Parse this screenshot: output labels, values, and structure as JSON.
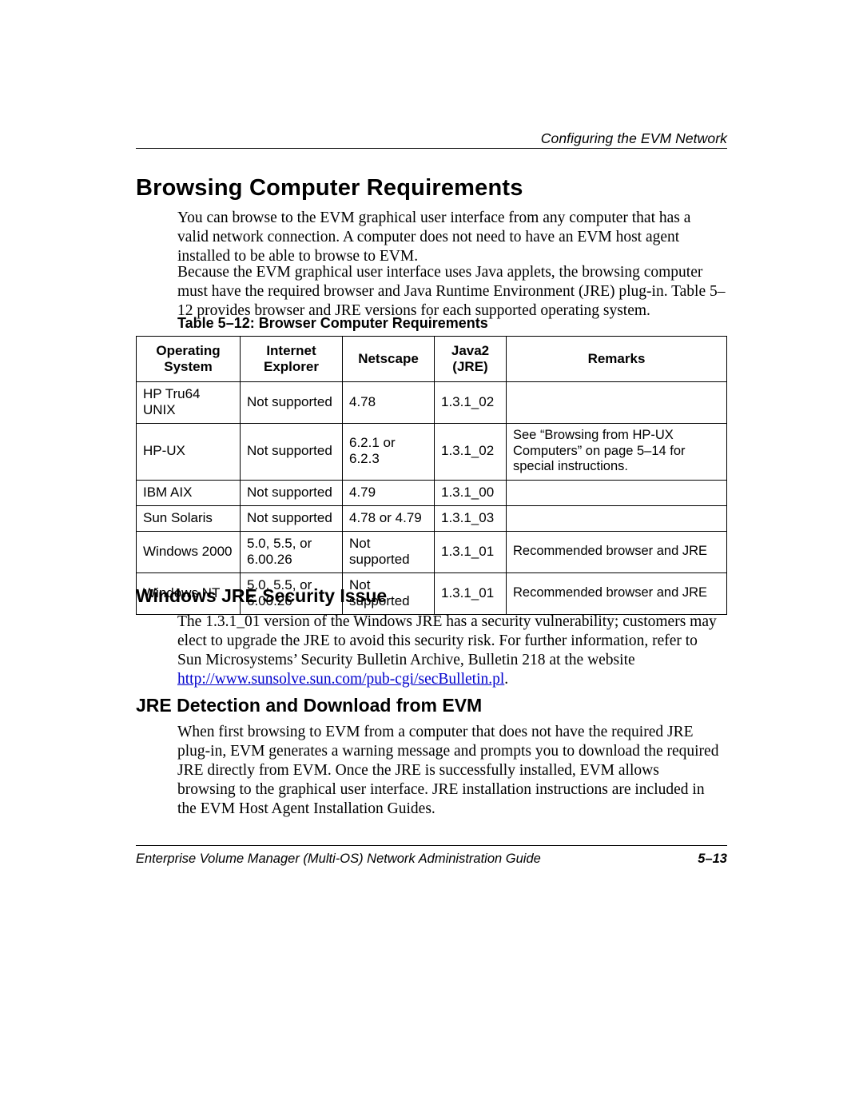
{
  "running_head": "Configuring the EVM Network",
  "heading1": "Browsing Computer Requirements",
  "para1": "You can browse to the EVM graphical user interface from any computer that has a valid network connection. A computer does not need to have an EVM host agent installed to be able to browse to EVM.",
  "para2": "Because the EVM graphical user interface uses Java applets, the browsing computer must have the required browser and Java Runtime Environment (JRE) plug-in. Table 5–12 provides browser and JRE versions for each supported operating system.",
  "table_caption": "Table 5–12:  Browser Computer Requirements",
  "table": {
    "headers": {
      "os": "Operating System",
      "ie": "Internet Explorer",
      "ns": "Netscape",
      "jre": "Java2 (JRE)",
      "rem": "Remarks"
    },
    "rows": [
      {
        "os": "HP Tru64 UNIX",
        "ie": "Not supported",
        "ns": "4.78",
        "jre": "1.3.1_02",
        "rem": ""
      },
      {
        "os": "HP-UX",
        "ie": "Not supported",
        "ns": "6.2.1 or 6.2.3",
        "jre": "1.3.1_02",
        "rem": "See “Browsing from HP-UX Computers” on page 5–14 for special instructions."
      },
      {
        "os": "IBM AIX",
        "ie": "Not supported",
        "ns": "4.79",
        "jre": "1.3.1_00",
        "rem": ""
      },
      {
        "os": "Sun Solaris",
        "ie": "Not supported",
        "ns": "4.78 or 4.79",
        "jre": "1.3.1_03",
        "rem": ""
      },
      {
        "os": "Windows 2000",
        "ie": "5.0, 5.5, or 6.00.26",
        "ns": "Not supported",
        "jre": "1.3.1_01",
        "rem": "Recommended browser and JRE"
      },
      {
        "os": "Windows NT",
        "ie": "5.0, 5.5, or 6.00.26",
        "ns": "Not supported",
        "jre": "1.3.1_01",
        "rem": "Recommended browser and JRE"
      }
    ]
  },
  "heading2a": "Windows JRE Security Issue",
  "para3_prefix": "The 1.3.1_01 version of the Windows JRE has a security vulnerability; customers may elect to upgrade the JRE to avoid this security risk. For further information, refer to Sun Microsystems’ Security Bulletin Archive, Bulletin 218 at the website ",
  "para3_link": "http://www.sunsolve.sun.com/pub-cgi/secBulletin.pl",
  "para3_suffix": ".",
  "heading2b": "JRE Detection and Download from EVM",
  "para4": "When first browsing to EVM from a computer that does not have the required JRE plug-in, EVM generates a warning message and prompts you to download the required JRE directly from EVM. Once the JRE is successfully installed, EVM allows browsing to the graphical user interface. JRE installation instructions are included in the EVM Host Agent Installation Guides.",
  "footer_title": "Enterprise Volume Manager (Multi-OS) Network Administration Guide",
  "footer_page": "5–13"
}
